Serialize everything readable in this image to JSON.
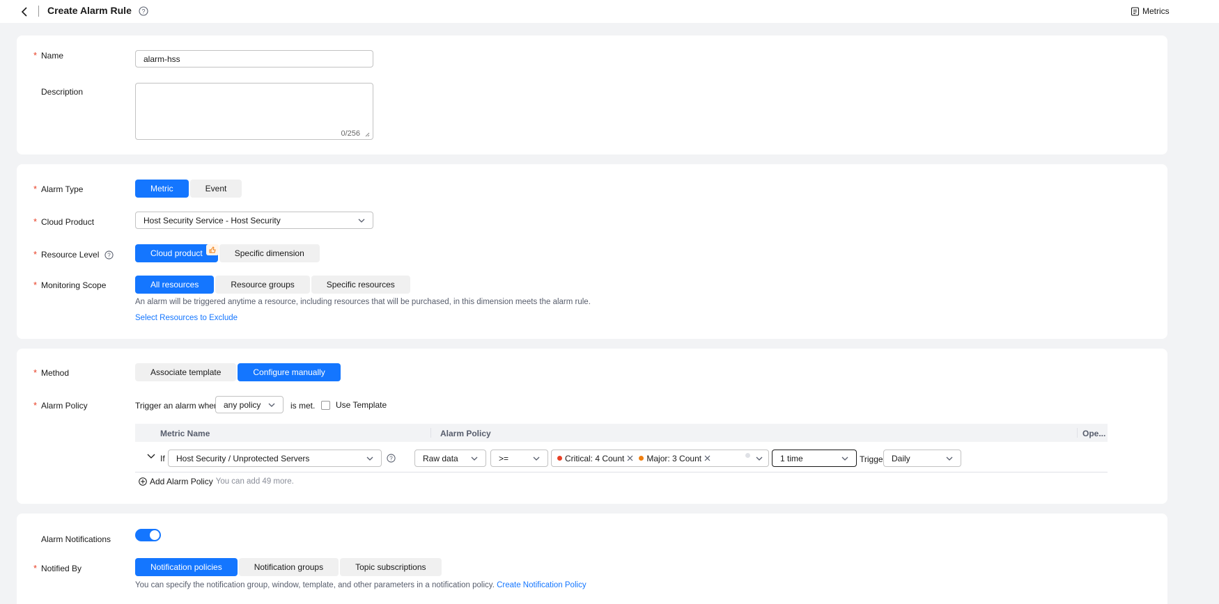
{
  "header": {
    "title": "Create Alarm Rule",
    "metrics_label": "Metrics"
  },
  "basic": {
    "name_label": "Name",
    "name_value": "alarm-hss",
    "description_label": "Description",
    "description_counter": "0/256"
  },
  "alarm": {
    "type_label": "Alarm Type",
    "type_options": [
      "Metric",
      "Event"
    ],
    "cloud_product_label": "Cloud Product",
    "cloud_product_value": "Host Security Service - Host Security",
    "resource_level_label": "Resource Level",
    "resource_level_options": [
      "Cloud product",
      "Specific dimension"
    ],
    "monitoring_scope_label": "Monitoring Scope",
    "monitoring_scope_options": [
      "All resources",
      "Resource groups",
      "Specific resources"
    ],
    "scope_hint": "An alarm will be triggered anytime a resource, including resources that will be purchased, in this dimension meets the alarm rule.",
    "exclude_link": "Select Resources to Exclude"
  },
  "method": {
    "label": "Method",
    "options": [
      "Associate template",
      "Configure manually"
    ],
    "policy_label": "Alarm Policy",
    "trigger_prefix": "Trigger an alarm when",
    "trigger_select": "any policy",
    "trigger_suffix": "is met.",
    "use_template_label": "Use Template",
    "table": {
      "col_metric": "Metric Name",
      "col_policy": "Alarm Policy",
      "col_ops": "Ope...",
      "row": {
        "if_label": "If",
        "metric": "Host Security / Unprotected Servers",
        "data_type": "Raw data",
        "operator": ">=",
        "tag1": "Critical: 4 Count",
        "tag2": "Major: 3 Count",
        "times": "1 time",
        "trigger_label": "Trigger",
        "frequency": "Daily"
      }
    },
    "add_policy_label": "Add Alarm Policy",
    "add_policy_hint": "You can add 49 more."
  },
  "notify": {
    "notifications_label": "Alarm Notifications",
    "notifications_on": true,
    "notified_by_label": "Notified By",
    "notified_by_options": [
      "Notification policies",
      "Notification groups",
      "Topic subscriptions"
    ],
    "hint": "You can specify the notification group, window, template, and other parameters in a notification policy.",
    "create_link": "Create Notification Policy"
  },
  "colors": {
    "primary": "#1476ff",
    "required": "#e84026",
    "critical": "#e84026",
    "major": "#f07f10"
  }
}
